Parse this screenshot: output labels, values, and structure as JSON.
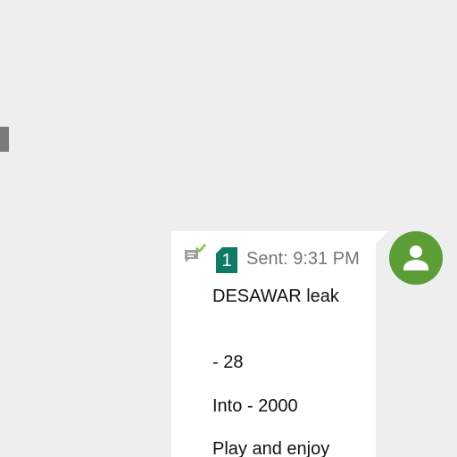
{
  "conversation": {
    "message": {
      "sim_slot": "1",
      "status_label": "Sent: 9:31 PM",
      "lines": [
        "DESAWAR leak",
        "- 28",
        "Into - 2000",
        "Play and enjoy"
      ],
      "delivery_icon": "delivered-check-icon",
      "sim_color": "#0f7a66"
    },
    "sender": {
      "avatar_icon": "person-icon",
      "avatar_color": "#5b9e35"
    }
  }
}
